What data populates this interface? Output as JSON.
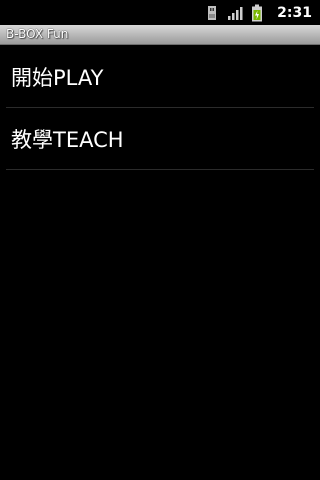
{
  "status_bar": {
    "icons": [
      "sd-card-icon",
      "signal-icon",
      "battery-icon"
    ],
    "time": "2:31"
  },
  "title_bar": {
    "title": "B-BOX Fun"
  },
  "menu": {
    "items": [
      {
        "label": "開始PLAY"
      },
      {
        "label": "教學TEACH"
      }
    ]
  },
  "colors": {
    "background": "#000000",
    "title_bar_top": "#d8d8d8",
    "title_bar_bottom": "#9a9a9a",
    "divider": "#2b2b2b",
    "battery": "#7ab800",
    "text": "#ffffff"
  }
}
